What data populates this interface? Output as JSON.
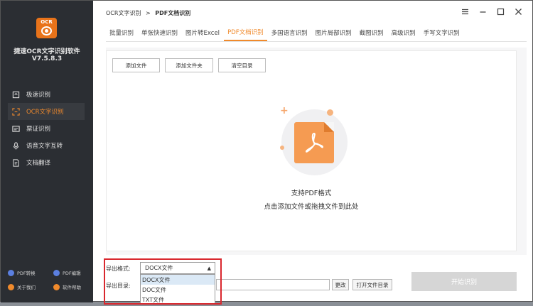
{
  "app": {
    "logo_text": "OCR",
    "name": "捷速OCR文字识别软件",
    "version": "V7.5.8.3"
  },
  "sidebar": {
    "items": [
      {
        "label": "极速识别",
        "icon": "fast-recognition-icon"
      },
      {
        "label": "OCR文字识别",
        "icon": "ocr-scan-icon",
        "active": true
      },
      {
        "label": "票证识别",
        "icon": "ticket-icon"
      },
      {
        "label": "语音文字互转",
        "icon": "microphone-icon"
      },
      {
        "label": "文档翻译",
        "icon": "document-translate-icon"
      }
    ],
    "bottom_links": [
      {
        "label": "PDF转换",
        "color": "#5b7fe0"
      },
      {
        "label": "PDF编辑",
        "color": "#5b7fe0"
      },
      {
        "label": "关于我们",
        "color": "#f08a2c"
      },
      {
        "label": "软件帮助",
        "color": "#f08a2c"
      }
    ]
  },
  "breadcrumb": {
    "parent": "OCR文字识别",
    "separator": ">",
    "current": "PDF文档识别"
  },
  "tabs": [
    "批量识别",
    "单张快速识别",
    "图片转Excel",
    "PDF文档识别",
    "多国语言识别",
    "图片局部识别",
    "截图识别",
    "高级识别",
    "手写文字识别"
  ],
  "active_tab": "PDF文档识别",
  "toolbar": {
    "add_file": "添加文件",
    "add_folder": "添加文件夹",
    "clear_list": "清空目录"
  },
  "dropzone": {
    "line1": "支持PDF格式",
    "line2": "点击添加文件或拖拽文件到此处"
  },
  "export": {
    "format_label": "导出格式:",
    "format_selected": "DOCX文件",
    "format_options": [
      "DOCX文件",
      "DOC文件",
      "TXT文件"
    ],
    "dir_label": "导出目录:",
    "change_button": "更改",
    "open_folder_button": "打开文件目录",
    "start_button": "开始识别"
  },
  "colors": {
    "accent": "#f08a2c",
    "sidebar_bg": "#2b2e33",
    "highlight_box": "#d9272e"
  }
}
